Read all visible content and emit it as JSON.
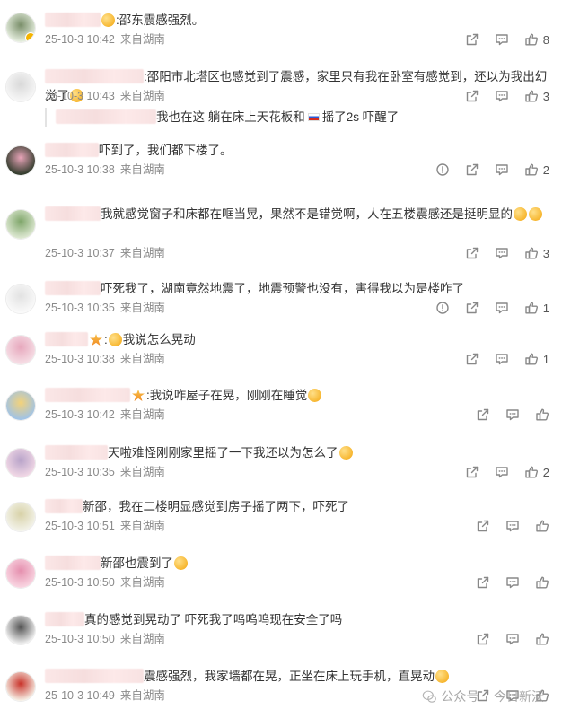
{
  "comments": [
    {
      "text": ":邵东震感强烈。",
      "time": "25-10-3 10:42",
      "location": "来自湖南",
      "likes": "8",
      "has_report": false,
      "avatar_colors": [
        "#e7efe0",
        "#7a8f6a"
      ]
    },
    {
      "text": ":邵阳市北塔区也感觉到了震感，家里只有我在卧室有感觉到，还以为我出幻觉了",
      "time": "25-10-3 10:43",
      "location": "来自湖南",
      "likes": "3",
      "has_report": false,
      "avatar_colors": [
        "#f7f7f7",
        "#d9d9d9"
      ],
      "reply": {
        "text_a": "我也在这 躺在床上天花板和",
        "text_b": "摇了2s 吓醒了"
      }
    },
    {
      "text": "吓到了，我们都下楼了。",
      "time": "25-10-3 10:38",
      "location": "来自湖南",
      "likes": "2",
      "has_report": true,
      "avatar_colors": [
        "#2f3a2a",
        "#e8a4b8"
      ]
    },
    {
      "text": "我就感觉窗子和床都在哐当晃，果然不是错觉啊，人在五楼震感还是挺明显的",
      "time": "25-10-3 10:37",
      "location": "来自湖南",
      "likes": "3",
      "has_report": false,
      "avatar_colors": [
        "#dfe9d4",
        "#7fa66a"
      ]
    },
    {
      "text": "吓死我了，湖南竟然地震了，地震预警也没有，害得我以为是楼咋了",
      "time": "25-10-3 10:35",
      "location": "来自湖南",
      "likes": "1",
      "has_report": true,
      "avatar_colors": [
        "#fafafa",
        "#e2e2e2"
      ]
    },
    {
      "text": ":我说怎么晃动",
      "time": "25-10-3 10:38",
      "location": "来自湖南",
      "likes": "1",
      "has_report": false,
      "avatar_colors": [
        "#f6dfe6",
        "#e7a8bd"
      ]
    },
    {
      "text": ":我说咋屋子在晃，刚刚在睡觉",
      "time": "25-10-3 10:42",
      "location": "来自湖南",
      "likes": "",
      "has_report": false,
      "avatar_colors": [
        "#9fc3e8",
        "#f3d27a"
      ]
    },
    {
      "text": "天啦难怪刚刚家里摇了一下我还以为怎么了",
      "time": "25-10-3 10:35",
      "location": "来自湖南",
      "likes": "2",
      "has_report": false,
      "avatar_colors": [
        "#f2d9e6",
        "#b8a3c9"
      ]
    },
    {
      "text": "新邵，我在二楼明显感觉到房子摇了两下，吓死了",
      "time": "25-10-3 10:51",
      "location": "来自湖南",
      "likes": "",
      "has_report": false,
      "avatar_colors": [
        "#f3f3ea",
        "#d8d2a8"
      ]
    },
    {
      "text": "新邵也震到了",
      "time": "25-10-3 10:50",
      "location": "来自湖南",
      "likes": "",
      "has_report": false,
      "avatar_colors": [
        "#f9d6e2",
        "#e58fae"
      ]
    },
    {
      "text": "真的感觉到晃动了 吓死我了呜呜呜现在安全了吗",
      "time": "25-10-3 10:50",
      "location": "来自湖南",
      "likes": "",
      "has_report": false,
      "avatar_colors": [
        "#f2f2f2",
        "#555555"
      ]
    },
    {
      "text": "震感强烈，我家墙都在晃，正坐在床上玩手机，直晃动",
      "time": "25-10-3 10:49",
      "location": "来自湖南",
      "likes": "",
      "has_report": false,
      "avatar_colors": [
        "#f6f0e6",
        "#c9342b"
      ]
    }
  ],
  "watermark": {
    "label": "公众号",
    "dot": "·",
    "name": "今日新沃"
  },
  "icons": [
    "share-icon",
    "comment-icon",
    "like-icon",
    "report-icon",
    "wechat-icon"
  ]
}
